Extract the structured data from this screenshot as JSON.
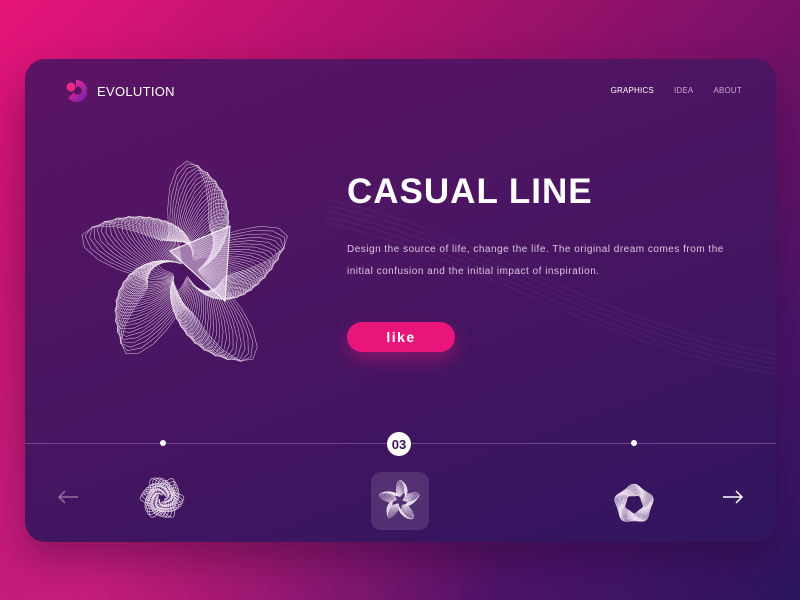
{
  "brand": {
    "name": "EVOLUTION",
    "logo_icon": "evolution-logo-icon"
  },
  "nav": {
    "items": [
      {
        "label": "GRAPHICS",
        "active": true
      },
      {
        "label": "IDEA",
        "active": false
      },
      {
        "label": "ABOUT",
        "active": false
      }
    ]
  },
  "hero": {
    "title": "CASUAL LINE",
    "description": "Design the source of life, change the life. The original dream comes from the initial confusion and the initial impact of inspiration.",
    "button_label": "like"
  },
  "carousel": {
    "current_page": "03",
    "prev_icon": "arrow-left-icon",
    "next_icon": "arrow-right-icon",
    "thumbnails": [
      {
        "icon": "swirl-flower-thumbnail",
        "active": false
      },
      {
        "icon": "line-star-thumbnail",
        "active": true
      },
      {
        "icon": "pentagon-thumbnail",
        "active": false
      }
    ]
  },
  "colors": {
    "accent": "#e8157a",
    "card_bg": "#4e1562",
    "text_primary": "#ffffff",
    "text_secondary": "#dcc6e0"
  }
}
